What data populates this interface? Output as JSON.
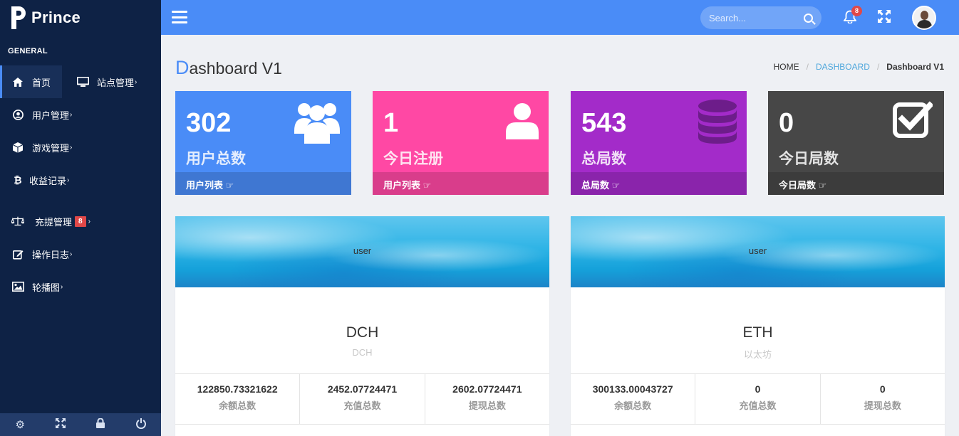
{
  "brand": {
    "name": "Prince"
  },
  "sidebar": {
    "section": "GENERAL",
    "items": [
      {
        "label": "首页",
        "icon": "home-icon",
        "chev": ""
      },
      {
        "label": "站点管理",
        "icon": "monitor-icon",
        "chev": "›"
      },
      {
        "label": "用户管理",
        "icon": "user-circle-icon",
        "chev": "›"
      },
      {
        "label": "游戏管理",
        "icon": "cube-icon",
        "chev": "›"
      },
      {
        "label": "收益记录",
        "icon": "bitcoin-icon",
        "chev": "›"
      },
      {
        "label": "充提管理",
        "icon": "balance-scale-icon",
        "chev": "›",
        "badge": "8"
      },
      {
        "label": "操作日志",
        "icon": "edit-icon",
        "chev": "›"
      },
      {
        "label": "轮播图",
        "icon": "image-icon",
        "chev": "›"
      }
    ]
  },
  "topbar": {
    "search_placeholder": "Search...",
    "notifications": "8"
  },
  "page": {
    "title_first": "D",
    "title_rest": "ashboard V1",
    "breadcrumb": {
      "home": "HOME",
      "sep": "/",
      "middle": "DASHBOARD",
      "current": "Dashboard V1"
    }
  },
  "stats": [
    {
      "value": "302",
      "label": "用户总数",
      "footer": "用户列表",
      "icon": "users-icon",
      "color": "#4a8cf7"
    },
    {
      "value": "1",
      "label": "今日注册",
      "footer": "用户列表",
      "icon": "user-icon",
      "color": "#ff48a4"
    },
    {
      "value": "543",
      "label": "总局数",
      "footer": "总局数",
      "icon": "database-icon",
      "color": "#a32bc9"
    },
    {
      "value": "0",
      "label": "今日局数",
      "footer": "今日局数",
      "icon": "checkbox-icon",
      "color": "#474747"
    }
  ],
  "coins": [
    {
      "user": "user",
      "name": "DCH",
      "sub": "DCH",
      "stats": [
        {
          "v": "122850.73321622",
          "k": "余额总数"
        },
        {
          "v": "2452.07724471",
          "k": "充值总数"
        },
        {
          "v": "2602.07724471",
          "k": "提现总数"
        }
      ]
    },
    {
      "user": "user",
      "name": "ETH",
      "sub": "以太坊",
      "stats": [
        {
          "v": "300133.00043727",
          "k": "余额总数"
        },
        {
          "v": "0",
          "k": "充值总数"
        },
        {
          "v": "0",
          "k": "提现总数"
        }
      ]
    }
  ]
}
